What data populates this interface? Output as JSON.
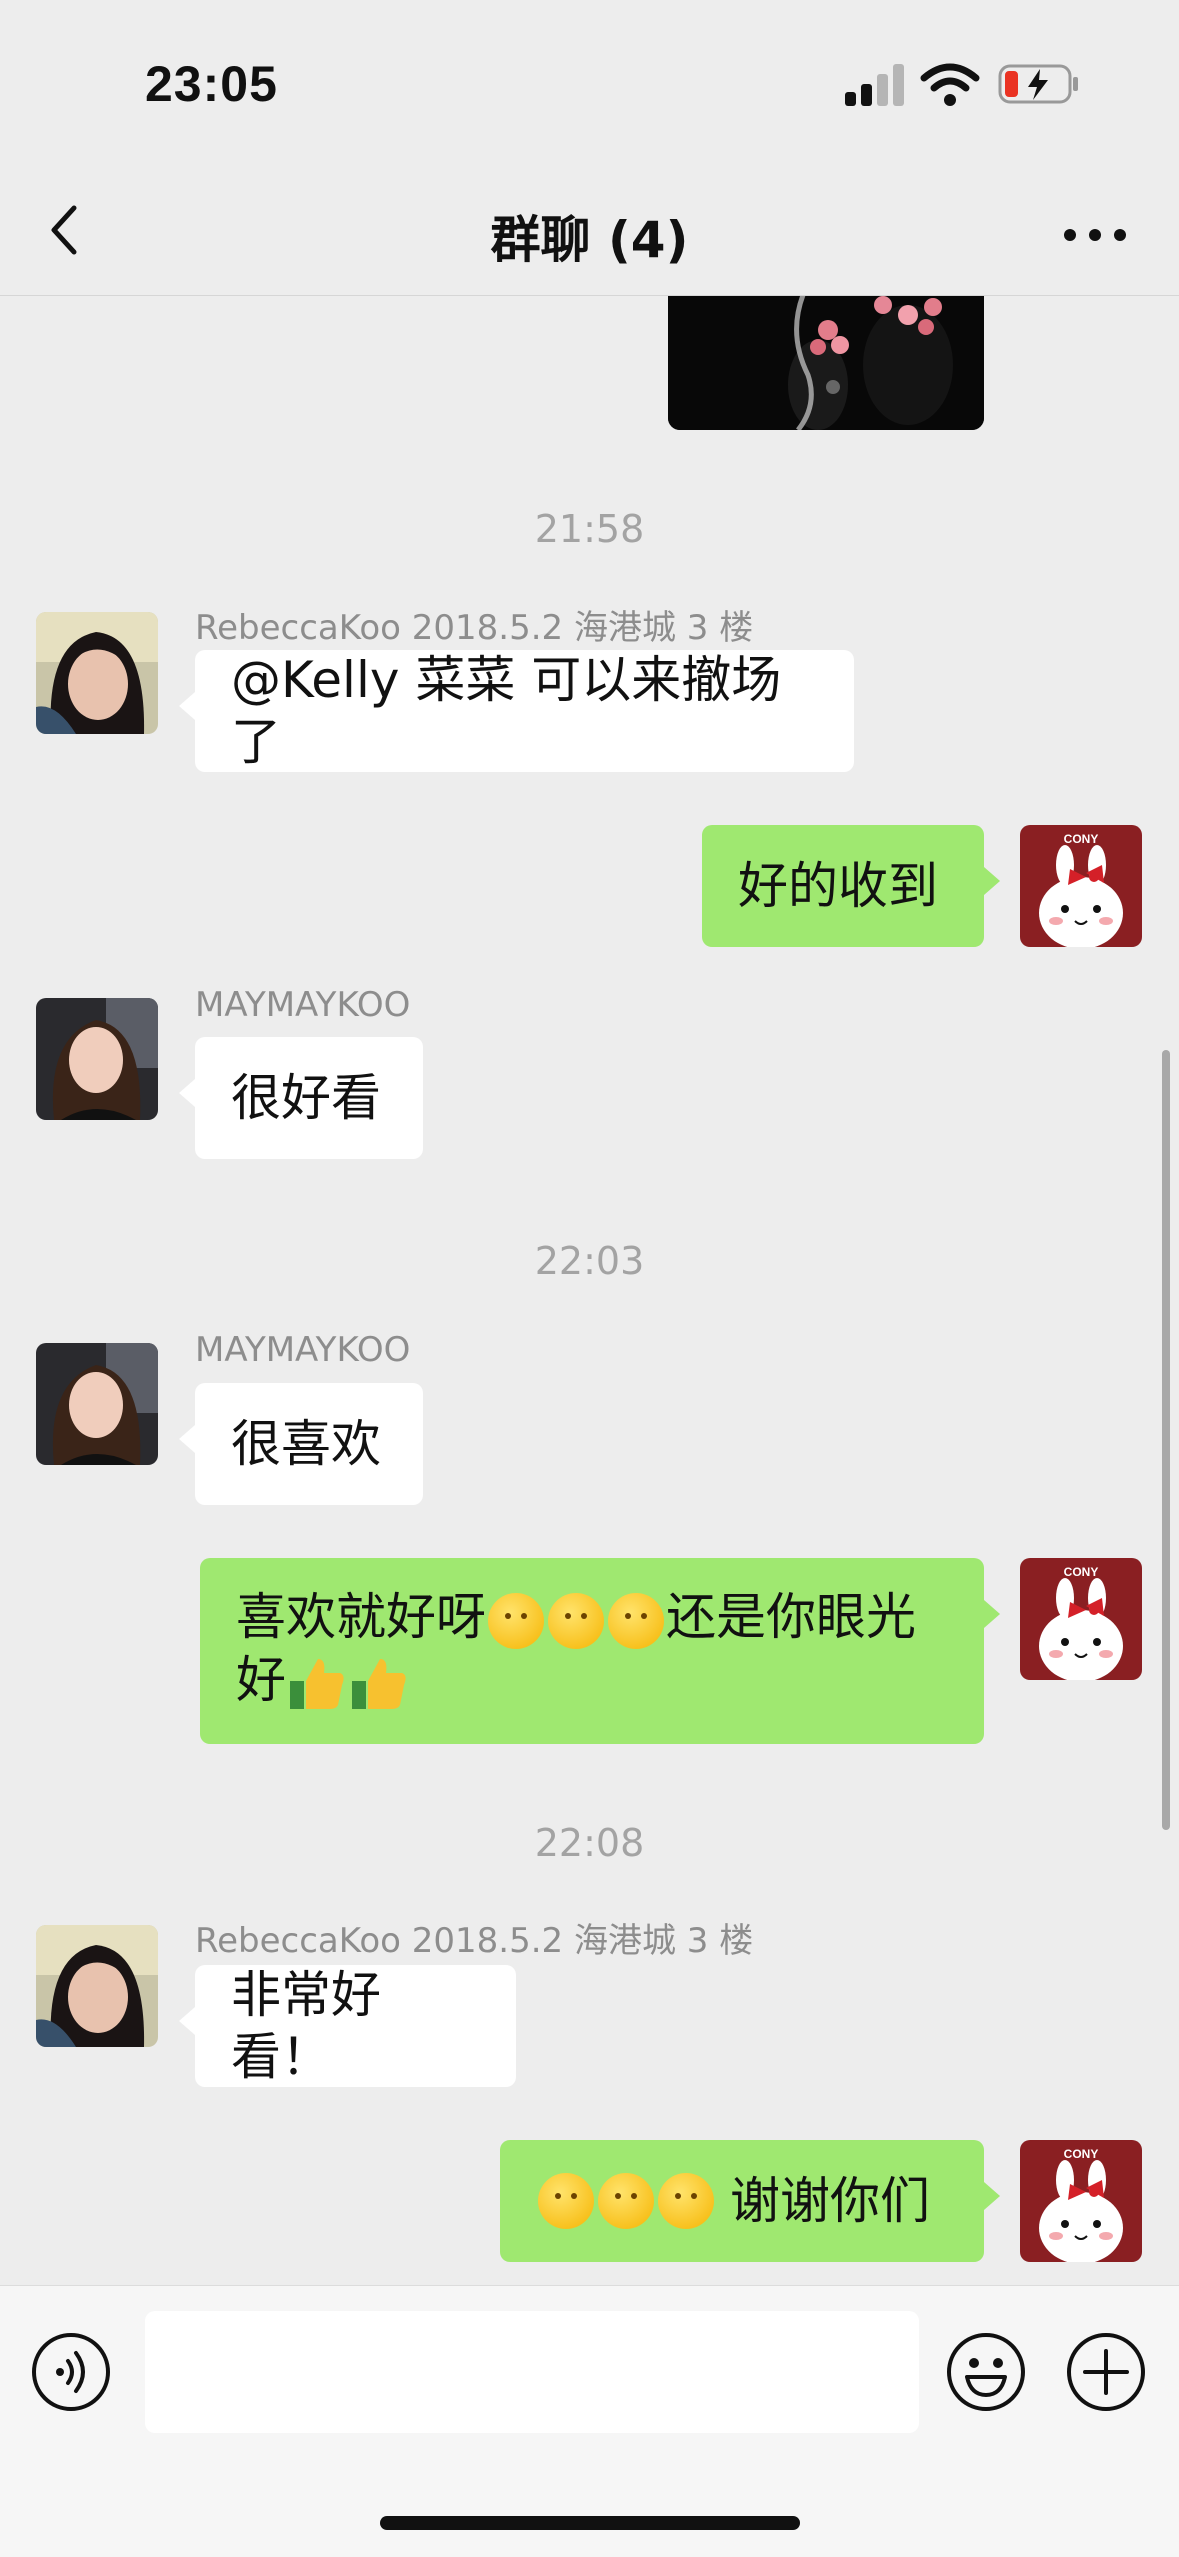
{
  "status_bar": {
    "time": "23:05"
  },
  "nav": {
    "title": "群聊 (4)"
  },
  "messages": [
    {
      "kind": "time",
      "text": "21:58"
    },
    {
      "kind": "in",
      "sender": "RebeccaKoo 2018.5.2 海港城 3 楼",
      "text": "@Kelly 菜菜 可以来撤场了"
    },
    {
      "kind": "out",
      "text": "好的收到"
    },
    {
      "kind": "in",
      "sender": "MAYMAYKOO",
      "text": "很好看"
    },
    {
      "kind": "time",
      "text": "22:03"
    },
    {
      "kind": "in",
      "sender": "MAYMAYKOO",
      "text": "很喜欢"
    },
    {
      "kind": "out",
      "text_a": "喜欢就好呀",
      "text_b": "还是你眼光",
      "text_c": "好"
    },
    {
      "kind": "time",
      "text": "22:08"
    },
    {
      "kind": "in",
      "sender": "RebeccaKoo 2018.5.2 海港城 3 楼",
      "text": "非常好看！"
    },
    {
      "kind": "out",
      "text": "谢谢你们"
    }
  ],
  "avatar_label": "CONY",
  "colors": {
    "background": "#ededed",
    "outgoing_bubble": "#9fe870",
    "incoming_bubble": "#ffffff",
    "time": "#a3a3a3"
  }
}
